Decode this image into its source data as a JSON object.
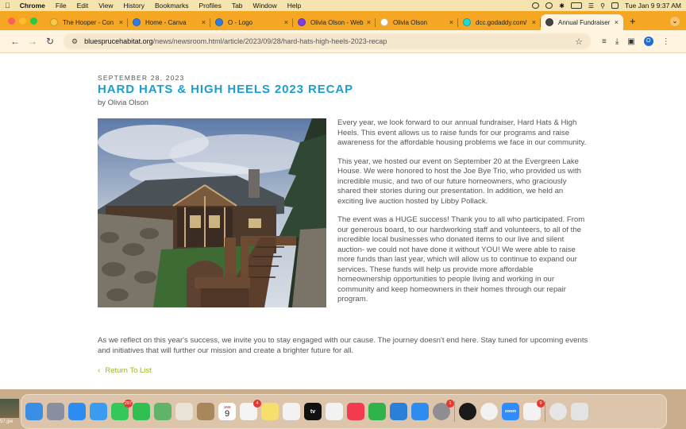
{
  "menubar": {
    "app_name": "Chrome",
    "menus": [
      "File",
      "Edit",
      "View",
      "History",
      "Bookmarks",
      "Profiles",
      "Tab",
      "Window",
      "Help"
    ],
    "clock": "Tue Jan 9  9:37 AM"
  },
  "tabs": [
    {
      "title": "The Hooper - Con",
      "favicon_color": "#f7c948",
      "active": false
    },
    {
      "title": "Home - Canva",
      "favicon_color": "#2f7de1",
      "active": false
    },
    {
      "title": "O - Logo",
      "favicon_color": "#2f7de1",
      "active": false
    },
    {
      "title": "Olivia Olson - Web",
      "favicon_color": "#7b3fe4",
      "active": false
    },
    {
      "title": "Olivia Olson",
      "favicon_color": "#ffffff",
      "active": false
    },
    {
      "title": "dcc.godaddy.com/",
      "favicon_color": "#1bdbdb",
      "active": false
    },
    {
      "title": "Annual Fundraiser",
      "favicon_color": "#444444",
      "active": true
    }
  ],
  "toolbar": {
    "url_host": "bluesprucehabitat.org",
    "url_path": "/news/newsroom.html/article/2023/09/28/hard-hats-high-heels-2023-recap",
    "profile_initial": "O"
  },
  "article": {
    "date": "SEPTEMBER 28, 2023",
    "title": "HARD HATS & HIGH HEELS 2023 RECAP",
    "byline": "by Olivia Olson",
    "paragraphs": [
      "Every year, we look forward to our annual fundraiser, Hard Hats & High Heels. This event allows us to raise funds for our programs and raise awareness for the affordable housing problems we face in our community.",
      "This year, we hosted our event on September 20 at the Evergreen Lake House. We were honored to host the Joe Bye Trio, who provided us with incredible music, and two of our future homeowners, who graciously shared their stories during our presentation. In addition, we held an exciting live auction hosted by Libby Pollack.",
      "The event was a HUGE success! Thank you to all who participated. From our generous board, to our hardworking staff and volunteers, to all of the incredible local businesses who donated items to our live and silent auction- we could not have done it without YOU! We were able to raise more funds than last year, which will allow us to continue to expand our services. These funds will help us provide more affordable homeownership opportunities to people living and working in our community and keep homeowners in their homes through our repair program."
    ],
    "closing": "As we reflect on this year's success, we invite you to stay engaged with our cause. The journey doesn't end here. Stay tuned for upcoming events and initiatives that will further our mission and create a brighter future for all.",
    "return_link": "Return To List"
  },
  "desktop": {
    "thumbnail_label": "57.jpe"
  },
  "dock": {
    "apps": [
      {
        "name": "finder",
        "color": "#3a8ee6",
        "badge": ""
      },
      {
        "name": "launchpad",
        "color": "#8a8fa0",
        "badge": ""
      },
      {
        "name": "safari",
        "color": "#2d8cf0",
        "badge": ""
      },
      {
        "name": "mail",
        "color": "#3a9bf0",
        "badge": ""
      },
      {
        "name": "messages",
        "color": "#34c759",
        "badge": "297"
      },
      {
        "name": "facetime",
        "color": "#2fbf52",
        "badge": ""
      },
      {
        "name": "maps",
        "color": "#5fb46a",
        "badge": ""
      },
      {
        "name": "photos",
        "color": "#e9e3d8",
        "badge": ""
      },
      {
        "name": "notes-book",
        "color": "#a8875a",
        "badge": ""
      },
      {
        "name": "calendar",
        "color": "#ffffff",
        "badge": ""
      },
      {
        "name": "reminders",
        "color": "#f4f4f4",
        "badge": "4"
      },
      {
        "name": "notes",
        "color": "#f7df6e",
        "badge": ""
      },
      {
        "name": "freeform",
        "color": "#f2f2f2",
        "badge": ""
      },
      {
        "name": "apple-tv",
        "color": "#111111",
        "badge": ""
      },
      {
        "name": "news",
        "color": "#f2f2f2",
        "badge": ""
      },
      {
        "name": "music",
        "color": "#f23b4e",
        "badge": ""
      },
      {
        "name": "numbers",
        "color": "#2fb34a",
        "badge": ""
      },
      {
        "name": "keynote",
        "color": "#2a7fd8",
        "badge": ""
      },
      {
        "name": "app-store",
        "color": "#2d8cf0",
        "badge": ""
      },
      {
        "name": "system-settings",
        "color": "#8d8d92",
        "badge": "1"
      },
      {
        "name": "spotify",
        "color": "#1a1a1a",
        "badge": ""
      },
      {
        "name": "chrome",
        "color": "#f2f2f2",
        "badge": ""
      },
      {
        "name": "zoom",
        "color": "#2d8cff",
        "badge": ""
      },
      {
        "name": "microsoft-office",
        "color": "#f2f2f2",
        "badge": "9"
      },
      {
        "name": "help",
        "color": "#e6e6e6",
        "badge": ""
      },
      {
        "name": "trash",
        "color": "#e4e4e4",
        "badge": ""
      }
    ],
    "calendar_month": "JAN",
    "calendar_day": "9",
    "tv_label": "tv",
    "zoom_label": "zoom"
  }
}
